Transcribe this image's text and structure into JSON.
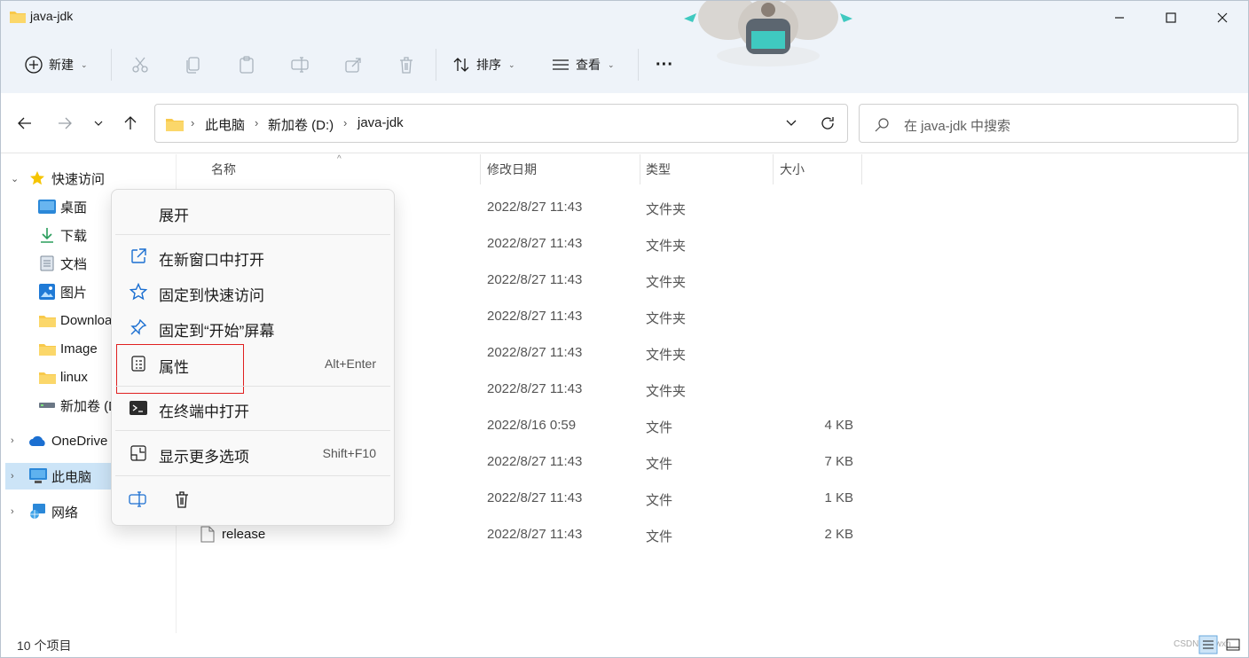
{
  "window": {
    "title": "java-jdk",
    "colors": {
      "accent": "#0067c0",
      "folder": "#f8c94b",
      "selection": "#cce4f7",
      "highlight_border": "#e02020"
    }
  },
  "toolbar": {
    "new_label": "新建",
    "sort_label": "排序",
    "view_label": "查看",
    "more_label": "···"
  },
  "address": {
    "crumbs": [
      "此电脑",
      "新加卷 (D:)",
      "java-jdk"
    ]
  },
  "search": {
    "placeholder": "在 java-jdk 中搜索"
  },
  "sidebar": {
    "items": [
      {
        "label": "快速访问",
        "icon": "star-icon"
      },
      {
        "label": "桌面",
        "icon": "desktop-icon"
      },
      {
        "label": "下载",
        "icon": "download-icon"
      },
      {
        "label": "文档",
        "icon": "document-icon"
      },
      {
        "label": "图片",
        "icon": "picture-icon"
      },
      {
        "label": "Downloads",
        "icon": "folder-icon"
      },
      {
        "label": "Image",
        "icon": "folder-icon"
      },
      {
        "label": "linux",
        "icon": "folder-icon"
      },
      {
        "label": "新加卷 (D:)",
        "icon": "drive-icon"
      },
      {
        "label": "OneDrive",
        "icon": "cloud-icon"
      },
      {
        "label": "此电脑",
        "icon": "computer-icon"
      },
      {
        "label": "网络",
        "icon": "network-icon"
      }
    ]
  },
  "columns": {
    "name": "名称",
    "modified": "修改日期",
    "type": "类型",
    "size": "大小"
  },
  "files": [
    {
      "name": "",
      "modified": "2022/8/27 11:43",
      "type": "文件夹",
      "size": ""
    },
    {
      "name": "",
      "modified": "2022/8/27 11:43",
      "type": "文件夹",
      "size": ""
    },
    {
      "name": "",
      "modified": "2022/8/27 11:43",
      "type": "文件夹",
      "size": ""
    },
    {
      "name": "",
      "modified": "2022/8/27 11:43",
      "type": "文件夹",
      "size": ""
    },
    {
      "name": "",
      "modified": "2022/8/27 11:43",
      "type": "文件夹",
      "size": ""
    },
    {
      "name": "",
      "modified": "2022/8/27 11:43",
      "type": "文件夹",
      "size": ""
    },
    {
      "name": "",
      "modified": "2022/8/16 0:59",
      "type": "文件",
      "size": "4 KB"
    },
    {
      "name": "",
      "modified": "2022/8/27 11:43",
      "type": "文件",
      "size": "7 KB"
    },
    {
      "name": "",
      "modified": "2022/8/27 11:43",
      "type": "文件",
      "size": "1 KB"
    },
    {
      "name": "release",
      "modified": "2022/8/27 11:43",
      "type": "文件",
      "size": "2 KB"
    }
  ],
  "context_menu": {
    "expand": "展开",
    "open_new_window": "在新窗口中打开",
    "pin_quick_access": "固定到快速访问",
    "pin_start": "固定到“开始”屏幕",
    "properties": "属性",
    "properties_shortcut": "Alt+Enter",
    "open_terminal": "在终端中打开",
    "more_options": "显示更多选项",
    "more_options_shortcut": "Shift+F10"
  },
  "status": {
    "item_count": "10 个项目"
  },
  "watermark": "CSDN @Lwxh"
}
